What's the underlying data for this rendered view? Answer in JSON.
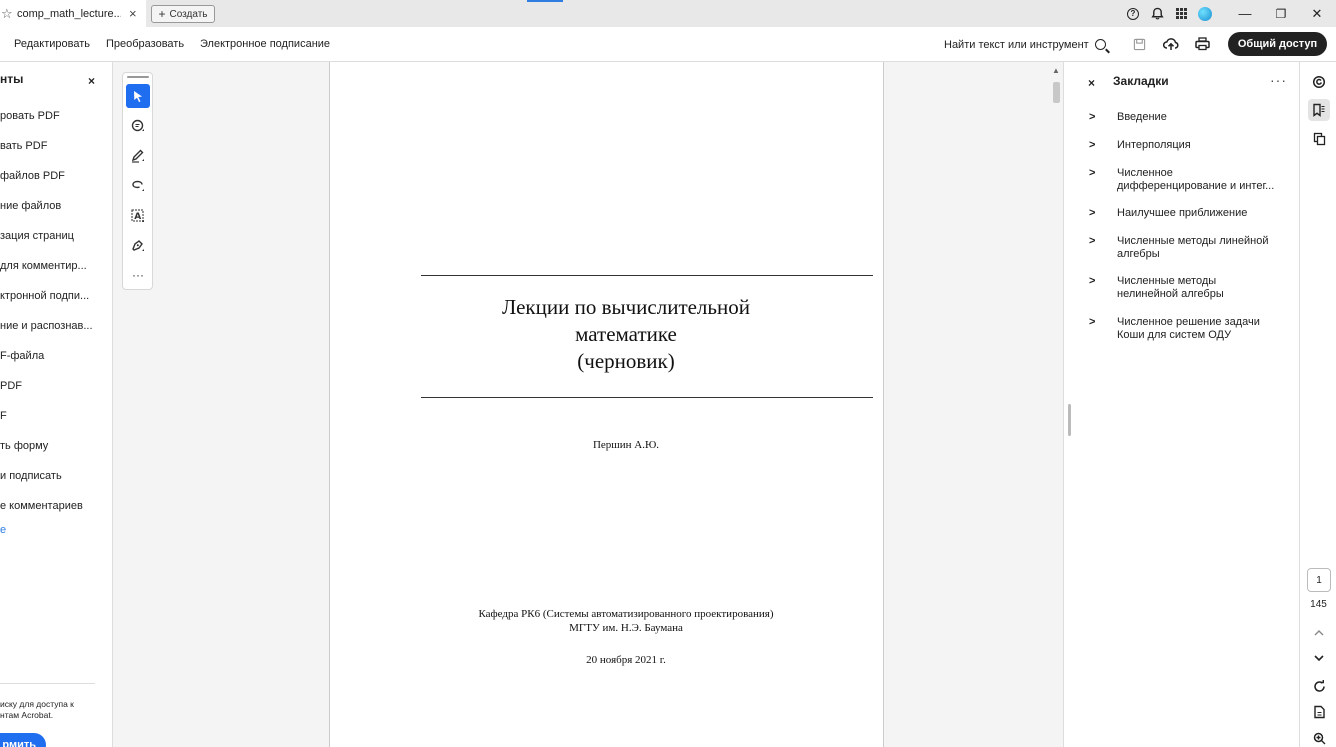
{
  "tab": {
    "title": "comp_math_lecture...",
    "close": "×"
  },
  "titlebar": {
    "new_label": "Создать",
    "help_glyph": "?",
    "minimize": "—",
    "restore": "❐",
    "close": "✕"
  },
  "menubar": {
    "items": [
      "Редактировать",
      "Преобразовать",
      "Электронное подписание"
    ],
    "find_label": "Найти текст или инструмент",
    "share_label": "Общий доступ"
  },
  "left_panel": {
    "title": "нты",
    "close": "×",
    "items": [
      "ровать PDF",
      "вать PDF",
      "файлов PDF",
      "ние файлов",
      "зация страниц",
      " для комментир...",
      "ктронной подпи...",
      "ние и распознав...",
      "F-файла",
      " PDF",
      "F",
      "ть форму",
      " и подписать",
      "е комментариев"
    ],
    "more_link": "е",
    "promo_text": "иску для доступа к\nнтам Acrobat.",
    "promo_button": "рмить"
  },
  "document": {
    "title_lines": [
      "Лекции по вычислительной",
      "математике",
      "(черновик)"
    ],
    "author": "Першин А.Ю.",
    "dept_line1": "Кафедра РК6 (Системы автоматизированного проектирования)",
    "dept_line2": "МГТУ им. Н.Э. Баумана",
    "date": "20 ноября 2021 г."
  },
  "bookmarks": {
    "title": "Закладки",
    "close": "×",
    "more": "···",
    "items": [
      "Введение",
      "Интерполяция",
      "Численное дифференцирование и интег...",
      "Наилучшее приближение",
      "Численные методы линейной алгебры",
      "Численные методы нелинейной алгебры",
      "Численное решение задачи Коши для систем ОДУ"
    ]
  },
  "navigation": {
    "current_page": "1",
    "total_pages": "145"
  },
  "colors": {
    "accent": "#1f6ef0",
    "share_bg": "#222222"
  }
}
